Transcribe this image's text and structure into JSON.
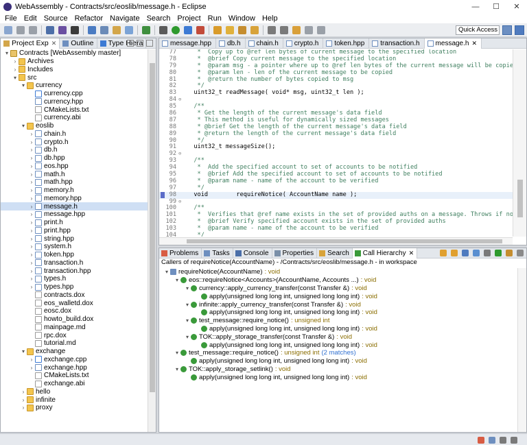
{
  "window": {
    "title": "WebAssembly - Contracts/src/eoslib/message.h - Eclipse",
    "buttons": {
      "minimize": "—",
      "maximize": "☐",
      "close": "✕"
    }
  },
  "menu": [
    "File",
    "Edit",
    "Source",
    "Refactor",
    "Navigate",
    "Search",
    "Project",
    "Run",
    "Window",
    "Help"
  ],
  "toolbar": {
    "quick_access": "Quick Access"
  },
  "left_panel": {
    "tabs": [
      {
        "label": "Project Exp",
        "active": true
      },
      {
        "label": "Outline",
        "active": false
      },
      {
        "label": "Type Hiera",
        "active": false
      }
    ],
    "tree": [
      {
        "label": "Contracts [WebAssembly master]",
        "level": 0,
        "arrow": "▾",
        "icon": "proj"
      },
      {
        "label": "Archives",
        "level": 1,
        "arrow": "›",
        "icon": "folder"
      },
      {
        "label": "Includes",
        "level": 1,
        "arrow": "›",
        "icon": "folder"
      },
      {
        "label": "src",
        "level": 1,
        "arrow": "▾",
        "icon": "folder"
      },
      {
        "label": "currency",
        "level": 2,
        "arrow": "▾",
        "icon": "folder"
      },
      {
        "label": "currency.cpp",
        "level": 3,
        "arrow": "",
        "icon": "file-cpp"
      },
      {
        "label": "currency.hpp",
        "level": 3,
        "arrow": "",
        "icon": "file-h"
      },
      {
        "label": "CMakeLists.txt",
        "level": 3,
        "arrow": "",
        "icon": "file-txt"
      },
      {
        "label": "currency.abi",
        "level": 3,
        "arrow": "",
        "icon": "file-txt"
      },
      {
        "label": "eoslib",
        "level": 2,
        "arrow": "▾",
        "icon": "folder"
      },
      {
        "label": "chain.h",
        "level": 3,
        "arrow": "›",
        "icon": "file-h"
      },
      {
        "label": "crypto.h",
        "level": 3,
        "arrow": "›",
        "icon": "file-h"
      },
      {
        "label": "db.h",
        "level": 3,
        "arrow": "›",
        "icon": "file-h"
      },
      {
        "label": "db.hpp",
        "level": 3,
        "arrow": "›",
        "icon": "file-h"
      },
      {
        "label": "eos.hpp",
        "level": 3,
        "arrow": "›",
        "icon": "file-h"
      },
      {
        "label": "math.h",
        "level": 3,
        "arrow": "›",
        "icon": "file-h"
      },
      {
        "label": "math.hpp",
        "level": 3,
        "arrow": "›",
        "icon": "file-h"
      },
      {
        "label": "memory.h",
        "level": 3,
        "arrow": "›",
        "icon": "file-h"
      },
      {
        "label": "memory.hpp",
        "level": 3,
        "arrow": "›",
        "icon": "file-h"
      },
      {
        "label": "message.h",
        "level": 3,
        "arrow": "›",
        "icon": "file-h",
        "selected": true
      },
      {
        "label": "message.hpp",
        "level": 3,
        "arrow": "›",
        "icon": "file-h"
      },
      {
        "label": "print.h",
        "level": 3,
        "arrow": "›",
        "icon": "file-h"
      },
      {
        "label": "print.hpp",
        "level": 3,
        "arrow": "›",
        "icon": "file-h"
      },
      {
        "label": "string.hpp",
        "level": 3,
        "arrow": "›",
        "icon": "file-h"
      },
      {
        "label": "system.h",
        "level": 3,
        "arrow": "›",
        "icon": "file-h"
      },
      {
        "label": "token.hpp",
        "level": 3,
        "arrow": "›",
        "icon": "file-h"
      },
      {
        "label": "transaction.h",
        "level": 3,
        "arrow": "›",
        "icon": "file-h"
      },
      {
        "label": "transaction.hpp",
        "level": 3,
        "arrow": "›",
        "icon": "file-h"
      },
      {
        "label": "types.h",
        "level": 3,
        "arrow": "›",
        "icon": "file-h"
      },
      {
        "label": "types.hpp",
        "level": 3,
        "arrow": "›",
        "icon": "file-h"
      },
      {
        "label": "contracts.dox",
        "level": 3,
        "arrow": "",
        "icon": "file-txt"
      },
      {
        "label": "eos_walletd.dox",
        "level": 3,
        "arrow": "",
        "icon": "file-txt"
      },
      {
        "label": "eosc.dox",
        "level": 3,
        "arrow": "",
        "icon": "file-txt"
      },
      {
        "label": "howto_build.dox",
        "level": 3,
        "arrow": "",
        "icon": "file-txt"
      },
      {
        "label": "mainpage.md",
        "level": 3,
        "arrow": "",
        "icon": "file-md"
      },
      {
        "label": "rpc.dox",
        "level": 3,
        "arrow": "",
        "icon": "file-txt"
      },
      {
        "label": "tutorial.md",
        "level": 3,
        "arrow": "",
        "icon": "file-md"
      },
      {
        "label": "exchange",
        "level": 2,
        "arrow": "▾",
        "icon": "folder"
      },
      {
        "label": "exchange.cpp",
        "level": 3,
        "arrow": "›",
        "icon": "file-cpp"
      },
      {
        "label": "exchange.hpp",
        "level": 3,
        "arrow": "›",
        "icon": "file-h"
      },
      {
        "label": "CMakeLists.txt",
        "level": 3,
        "arrow": "",
        "icon": "file-txt"
      },
      {
        "label": "exchange.abi",
        "level": 3,
        "arrow": "",
        "icon": "file-txt"
      },
      {
        "label": "hello",
        "level": 2,
        "arrow": "›",
        "icon": "folder"
      },
      {
        "label": "infinite",
        "level": 2,
        "arrow": "›",
        "icon": "folder"
      },
      {
        "label": "proxy",
        "level": 2,
        "arrow": "›",
        "icon": "folder"
      }
    ]
  },
  "editor": {
    "tabs": [
      {
        "label": "message.hpp",
        "active": false
      },
      {
        "label": "db.h",
        "active": false
      },
      {
        "label": "chain.h",
        "active": false
      },
      {
        "label": "crypto.h",
        "active": false
      },
      {
        "label": "token.hpp",
        "active": false
      },
      {
        "label": "transaction.h",
        "active": false
      },
      {
        "label": "message.h",
        "active": true
      }
    ],
    "lines": [
      {
        "n": "77",
        "fold": "",
        "text": "   *  Copy up to @ref len bytes of current message to the specified location",
        "kind": "cmt"
      },
      {
        "n": "78",
        "fold": "",
        "text": "   *  @brief Copy current message to the specified location",
        "kind": "cmt"
      },
      {
        "n": "79",
        "fold": "",
        "text": "   *  @param msg - a pointer where up to @ref len bytes of the current message will be copied",
        "kind": "cmt"
      },
      {
        "n": "80",
        "fold": "",
        "text": "   *  @param len - len of the current message to be copied",
        "kind": "cmt"
      },
      {
        "n": "81",
        "fold": "",
        "text": "   *  @return the number of bytes copied to msg",
        "kind": "cmt"
      },
      {
        "n": "82",
        "fold": "",
        "text": "   */",
        "kind": "cmt"
      },
      {
        "n": "83",
        "fold": "",
        "text": "  uint32_t readMessage( void* msg, uint32_t len );",
        "kind": "code"
      },
      {
        "n": "84",
        "fold": "⊖",
        "text": "",
        "kind": "code"
      },
      {
        "n": "85",
        "fold": "",
        "text": "  /**",
        "kind": "cmt"
      },
      {
        "n": "86",
        "fold": "",
        "text": "   * Get the length of the current message's data field",
        "kind": "cmt"
      },
      {
        "n": "87",
        "fold": "",
        "text": "   * This method is useful for dynamically sized messages",
        "kind": "cmt"
      },
      {
        "n": "88",
        "fold": "",
        "text": "   * @brief Get the length of the current message's data field",
        "kind": "cmt"
      },
      {
        "n": "89",
        "fold": "",
        "text": "   * @return the length of the current message's data field",
        "kind": "cmt"
      },
      {
        "n": "90",
        "fold": "",
        "text": "   */",
        "kind": "cmt"
      },
      {
        "n": "91",
        "fold": "",
        "text": "  uint32_t messageSize();",
        "kind": "code"
      },
      {
        "n": "92",
        "fold": "⊖",
        "text": "",
        "kind": "code"
      },
      {
        "n": "93",
        "fold": "",
        "text": "  /**",
        "kind": "cmt"
      },
      {
        "n": "94",
        "fold": "",
        "text": "   *  Add the specified account to set of accounts to be notified",
        "kind": "cmt"
      },
      {
        "n": "95",
        "fold": "",
        "text": "   *  @brief Add the specified account to set of accounts to be notified",
        "kind": "cmt"
      },
      {
        "n": "96",
        "fold": "",
        "text": "   *  @param name - name of the account to be verified",
        "kind": "cmt"
      },
      {
        "n": "97",
        "fold": "",
        "text": "   */",
        "kind": "cmt"
      },
      {
        "n": "98",
        "fold": "",
        "text": "  void        requireNotice( AccountName name );",
        "kind": "code",
        "highlight": true
      },
      {
        "n": "99",
        "fold": "⊖",
        "text": "",
        "kind": "code"
      },
      {
        "n": "100",
        "fold": "",
        "text": "  /**",
        "kind": "cmt"
      },
      {
        "n": "101",
        "fold": "",
        "text": "   *  Verifies that @ref name exists in the set of provided auths on a message. Throws if not found",
        "kind": "cmt"
      },
      {
        "n": "102",
        "fold": "",
        "text": "   *  @brief Verify specified account exists in the set of provided auths",
        "kind": "cmt"
      },
      {
        "n": "103",
        "fold": "",
        "text": "   *  @param name - name of the account to be verified",
        "kind": "cmt"
      },
      {
        "n": "104",
        "fold": "",
        "text": "   */",
        "kind": "cmt"
      }
    ]
  },
  "bottom_panel": {
    "tabs": [
      {
        "label": "Problems",
        "active": false
      },
      {
        "label": "Tasks",
        "active": false
      },
      {
        "label": "Console",
        "active": false
      },
      {
        "label": "Properties",
        "active": false
      },
      {
        "label": "Search",
        "active": false
      },
      {
        "label": "Call Hierarchy",
        "active": true
      }
    ],
    "callers_header": "Callers of requireNotice(AccountName) - /Contracts/src/eoslib/message.h - in workspace",
    "hierarchy": [
      {
        "level": 0,
        "arrow": "▾",
        "name": "requireNotice(AccountName)",
        "ret": ": void",
        "match": "",
        "root": true
      },
      {
        "level": 1,
        "arrow": "▾",
        "name": "eos::requireNotice<Accounts>(AccountName, Accounts ...)",
        "ret": ": void",
        "match": ""
      },
      {
        "level": 2,
        "arrow": "▾",
        "name": "currency::apply_currency_transfer(const Transfer &)",
        "ret": ": void",
        "match": ""
      },
      {
        "level": 3,
        "arrow": "",
        "name": "apply(unsigned long long int, unsigned long long int)",
        "ret": ": void",
        "match": ""
      },
      {
        "level": 2,
        "arrow": "▾",
        "name": "infinite::apply_currency_transfer(const Transfer &)",
        "ret": ": void",
        "match": ""
      },
      {
        "level": 3,
        "arrow": "",
        "name": "apply(unsigned long long int, unsigned long long int)",
        "ret": ": void",
        "match": ""
      },
      {
        "level": 2,
        "arrow": "▾",
        "name": "test_message::require_notice()",
        "ret": ": unsigned int",
        "match": ""
      },
      {
        "level": 3,
        "arrow": "",
        "name": "apply(unsigned long long int, unsigned long long int)",
        "ret": ": void",
        "match": ""
      },
      {
        "level": 2,
        "arrow": "▾",
        "name": "TOK::apply_storage_transfer(const Transfer &)",
        "ret": ": void",
        "match": ""
      },
      {
        "level": 3,
        "arrow": "",
        "name": "apply(unsigned long long int, unsigned long long int)",
        "ret": ": void",
        "match": ""
      },
      {
        "level": 1,
        "arrow": "▾",
        "name": "test_message::require_notice()",
        "ret": ": unsigned int",
        "match": "(2 matches)"
      },
      {
        "level": 2,
        "arrow": "",
        "name": "apply(unsigned long long int, unsigned long long int)",
        "ret": ": void",
        "match": ""
      },
      {
        "level": 1,
        "arrow": "▾",
        "name": "TOK::apply_storage_setlink()",
        "ret": ": void",
        "match": ""
      },
      {
        "level": 2,
        "arrow": "",
        "name": "apply(unsigned long long int, unsigned long long int)",
        "ret": ": void",
        "match": ""
      }
    ]
  }
}
